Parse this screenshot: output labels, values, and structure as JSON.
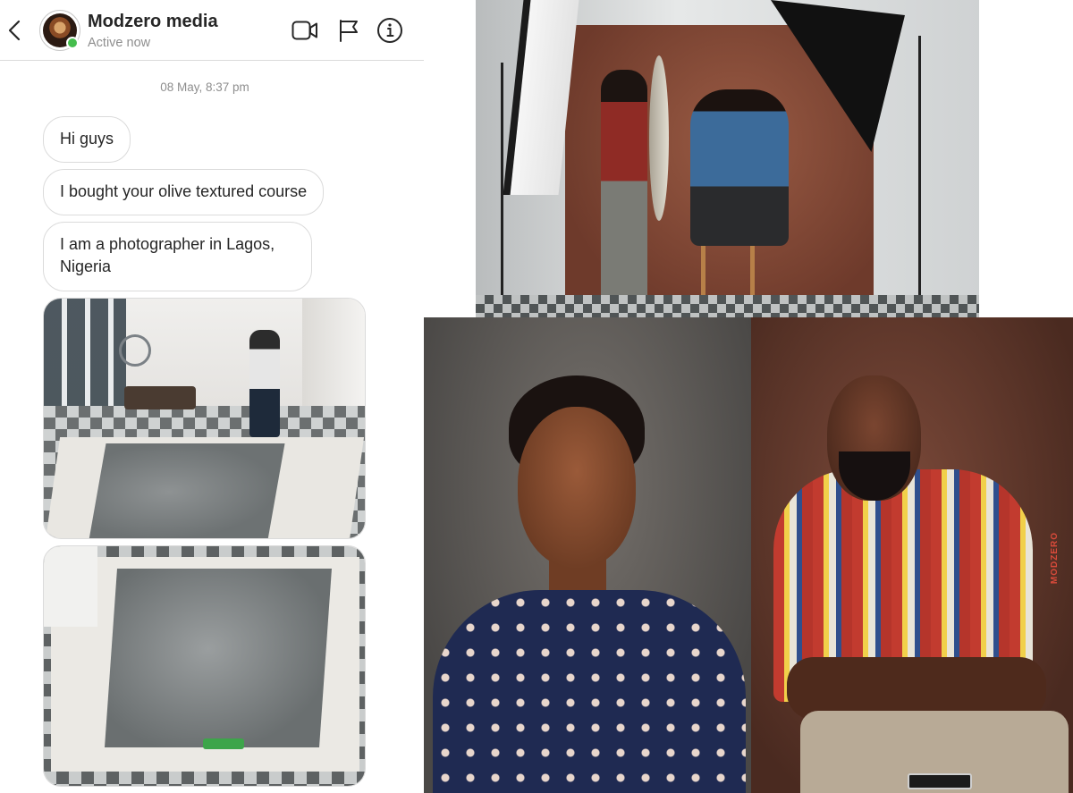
{
  "chat": {
    "header": {
      "contact_name": "Modzero media",
      "status": "Active now",
      "icons": [
        "chevron-left-icon",
        "video-camera-icon",
        "flag-icon",
        "info-icon"
      ],
      "online_color": "#45bd4d"
    },
    "timestamp": "08 May, 8:37 pm",
    "messages": [
      {
        "text": "Hi guys"
      },
      {
        "text": "I bought your olive textured course"
      },
      {
        "text": "I am a photographer in Lagos, Nigeria"
      }
    ],
    "attachments": [
      "photo",
      "photo"
    ]
  },
  "gallery": {
    "watermark": "MODZERO"
  },
  "colors": {
    "text_primary": "#262626",
    "text_secondary": "#8e8e8e",
    "border": "#dbdbdb"
  }
}
